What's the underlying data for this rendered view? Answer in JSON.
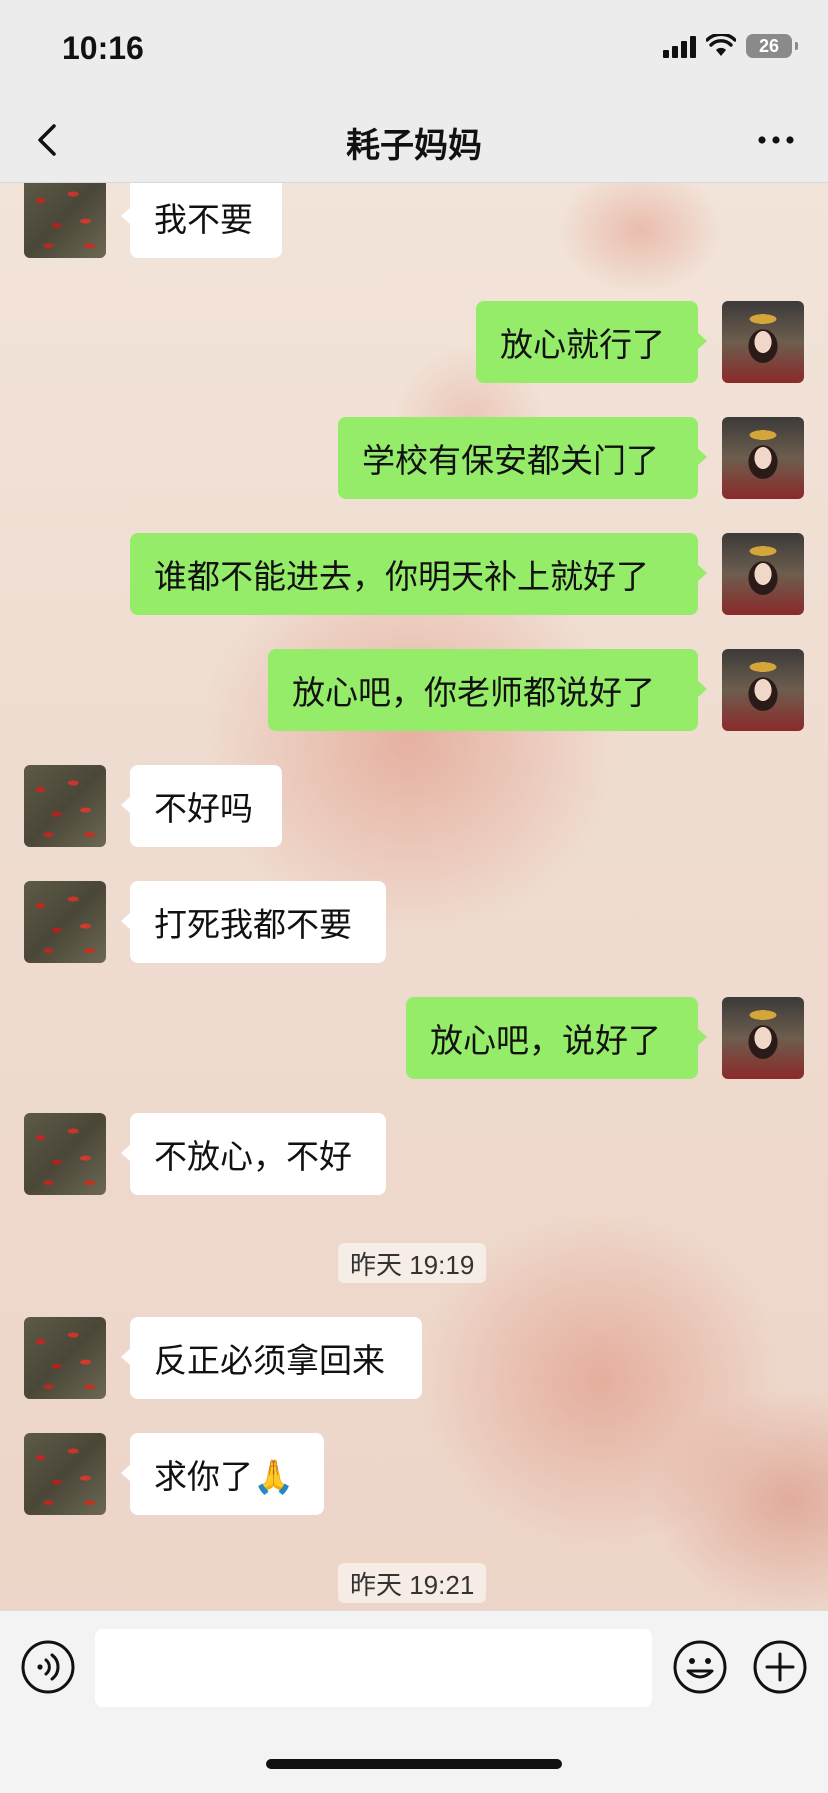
{
  "status_bar": {
    "time": "10:16",
    "battery": "26"
  },
  "nav": {
    "title": "耗子妈妈",
    "back_icon": "chevron-left-icon",
    "more_icon": "more-horizontal-icon"
  },
  "messages": [
    {
      "side": "in",
      "text": "我不要"
    },
    {
      "side": "out",
      "text": "放心就行了"
    },
    {
      "side": "out",
      "text": "学校有保安都关门了"
    },
    {
      "side": "out",
      "text": "谁都不能进去，你明天补上就好了"
    },
    {
      "side": "out",
      "text": "放心吧，你老师都说好了"
    },
    {
      "side": "in",
      "text": "不好吗"
    },
    {
      "side": "in",
      "text": "打死我都不要"
    },
    {
      "side": "out",
      "text": "放心吧，说好了"
    },
    {
      "side": "in",
      "text": "不放心，不好"
    },
    {
      "side": "time",
      "text": "昨天 19:19"
    },
    {
      "side": "in",
      "text": "反正必须拿回来"
    },
    {
      "side": "in",
      "text": "求你了🙏"
    },
    {
      "side": "time",
      "text": "昨天 19:21"
    }
  ],
  "input_bar": {
    "value": "",
    "voice_icon": "voice-icon",
    "emoji_icon": "emoji-icon",
    "plus_icon": "plus-icon"
  },
  "colors": {
    "outgoing_bubble": "#95ec69",
    "incoming_bubble": "#ffffff",
    "bar_background": "#ececec"
  }
}
